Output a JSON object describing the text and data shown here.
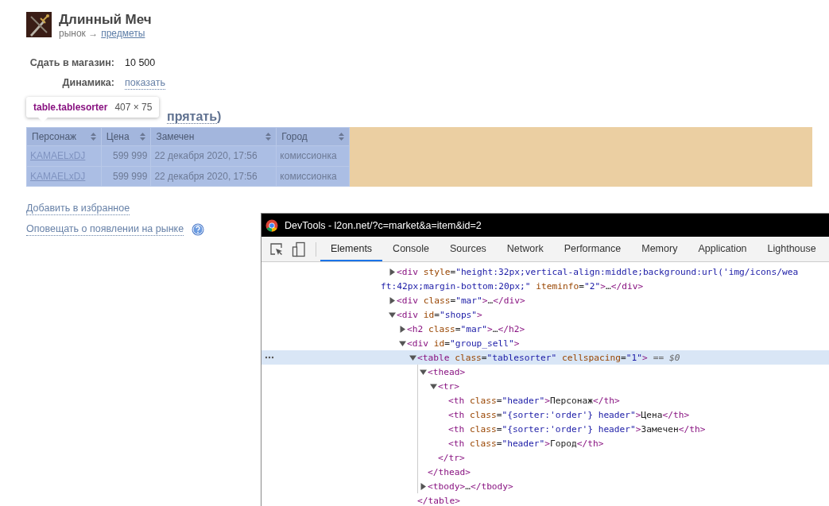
{
  "item": {
    "title": "Длинный Меч",
    "breadcrumb": "рынок →",
    "breadcrumb_link": "предметы"
  },
  "fields": [
    {
      "label": "Сдать в магазин:",
      "value": "10 500",
      "kind": "text"
    },
    {
      "label": "Динамика:",
      "value": "показать",
      "kind": "link"
    }
  ],
  "section": {
    "toggle_link": "прятать",
    "paren": ")"
  },
  "inspect_tooltip": {
    "selector": "table.tablesorter",
    "size": "407 × 75"
  },
  "table": {
    "columns": [
      "Персонаж",
      "Цена",
      "Замечен",
      "Город"
    ],
    "rows": [
      [
        "KAMAELxDJ",
        "599 999",
        "22 декабря 2020, 17:56",
        "комиссионка"
      ],
      [
        "KAMAELxDJ",
        "599 999",
        "22 декабря 2020, 17:56",
        "комиссионка"
      ]
    ]
  },
  "links": [
    {
      "text": "Добавить в избранное",
      "help": false
    },
    {
      "text": "Оповещать о появлении на рынке",
      "help": true
    }
  ],
  "devtools": {
    "title": "DevTools - l2on.net/?c=market&a=item&id=2",
    "tabs": [
      {
        "label": "Elements",
        "selected": true
      },
      {
        "label": "Console",
        "selected": false
      },
      {
        "label": "Sources",
        "selected": false
      },
      {
        "label": "Network",
        "selected": false
      },
      {
        "label": "Performance",
        "selected": false
      },
      {
        "label": "Memory",
        "selected": false
      },
      {
        "label": "Application",
        "selected": false
      },
      {
        "label": "Lighthouse",
        "selected": false
      }
    ],
    "dom_tree": [
      {
        "text": "<div style=\"height:32px;vertical-align:middle;background:url('img/icons/wea",
        "wrap": "ft:42px;margin-bottom:20px;\" iteminfo=\"2\">…</div>",
        "expanded": false,
        "selected": false
      },
      {
        "text": "<div class=\"mar\">…</div>",
        "expanded": false,
        "selected": false
      },
      {
        "text": "<div id=\"shops\">",
        "expanded": true,
        "selected": false,
        "children": [
          {
            "text": "<h2 class=\"mar\">…</h2>",
            "expanded": false,
            "selected": false
          },
          {
            "text": "<div id=\"group_sell\">",
            "expanded": true,
            "selected": false,
            "children": [
              {
                "text": "<table class=\"tablesorter\" cellspacing=\"1\">",
                "suffix": "== $0",
                "expanded": true,
                "selected": true,
                "closing": "</table>",
                "children": [
                  {
                    "text": "<thead>",
                    "expanded": true,
                    "selected": false,
                    "closing": "</thead>",
                    "children": [
                      {
                        "text": "<tr>",
                        "expanded": true,
                        "selected": false,
                        "closing": "</tr>",
                        "children": [
                          {
                            "text": "<th class=\"header\">Персонаж</th>",
                            "selected": false
                          },
                          {
                            "text": "<th class=\"{sorter:'order'} header\">Цена</th>",
                            "selected": false
                          },
                          {
                            "text": "<th class=\"{sorter:'order'} header\">Замечен</th>",
                            "selected": false
                          },
                          {
                            "text": "<th class=\"header\">Город</th>",
                            "selected": false
                          }
                        ]
                      }
                    ]
                  },
                  {
                    "text": "<tbody>…</tbody>",
                    "expanded": false,
                    "selected": false
                  }
                ]
              }
            ]
          }
        ]
      }
    ]
  }
}
